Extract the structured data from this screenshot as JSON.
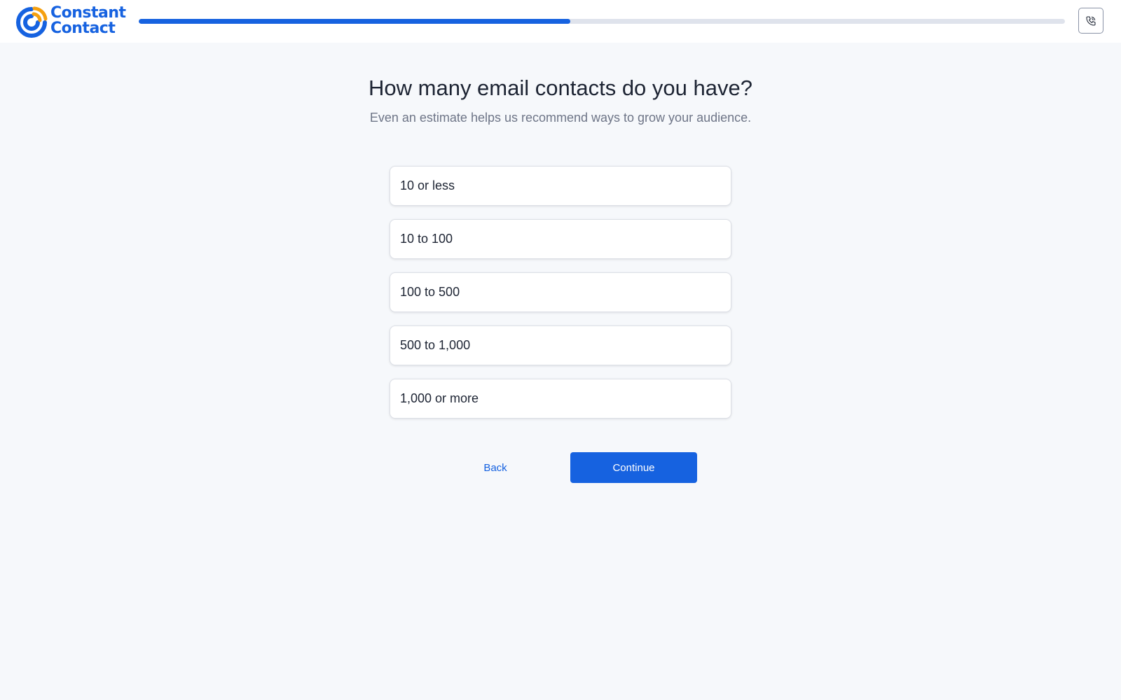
{
  "header": {
    "logo_line1": "Constant",
    "logo_line2": "Contact",
    "progress": 0.466,
    "phone_icon": "phone-icon"
  },
  "main": {
    "question": "How many email contacts do you have?",
    "subtitle": "Even an estimate helps us recommend ways to grow your audience.",
    "options": [
      {
        "label": "10 or less"
      },
      {
        "label": "10 to 100"
      },
      {
        "label": "100 to 500"
      },
      {
        "label": "500 to 1,000"
      },
      {
        "label": "1,000 or more"
      }
    ],
    "back_label": "Back",
    "continue_label": "Continue"
  },
  "colors": {
    "brand_blue": "#1662e0",
    "brand_orange": "#f5a00f",
    "page_bg": "#f6f8fb",
    "text_dark": "#1d2433",
    "text_muted": "#6e7587"
  }
}
